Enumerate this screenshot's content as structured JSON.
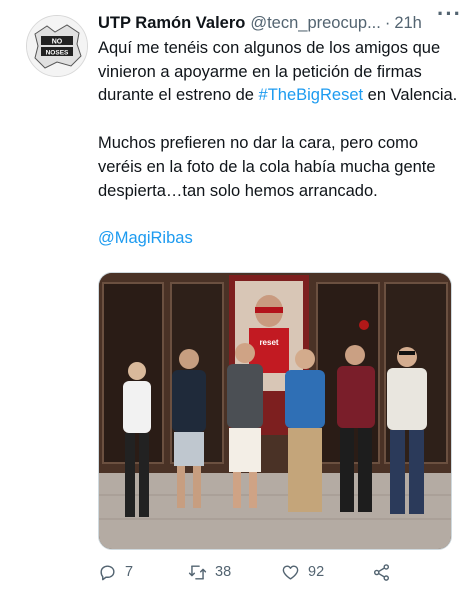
{
  "tweet": {
    "author_name": "UTP Ramón Valero",
    "author_handle": "@tecn_preocup...",
    "separator": "·",
    "time": "21h",
    "avatar_text_top": "NO",
    "avatar_text_bottom": "NOSES",
    "text": {
      "p1_before": "Aquí me tenéis con algunos de los amigos que vinieron a apoyarme en la petición de firmas durante el estreno de ",
      "p1_hashtag": "#TheBigReset",
      "p1_after": " en Valencia.",
      "p2": "Muchos prefieren no dar la cara, pero como veréis en la foto de la cola había mucha gente despierta…tan solo hemos arrancado.",
      "mention": "@MagiRibas"
    },
    "poster_text": "reset",
    "stats": {
      "replies": "7",
      "retweets": "38",
      "likes": "92"
    }
  },
  "icons": {
    "more": "more-horizontal-icon",
    "reply": "reply-icon",
    "retweet": "retweet-icon",
    "like": "heart-icon",
    "share": "share-icon"
  },
  "colors": {
    "link": "#1d9bf0",
    "secondary_text": "#536471",
    "primary_text": "#0f1419"
  }
}
